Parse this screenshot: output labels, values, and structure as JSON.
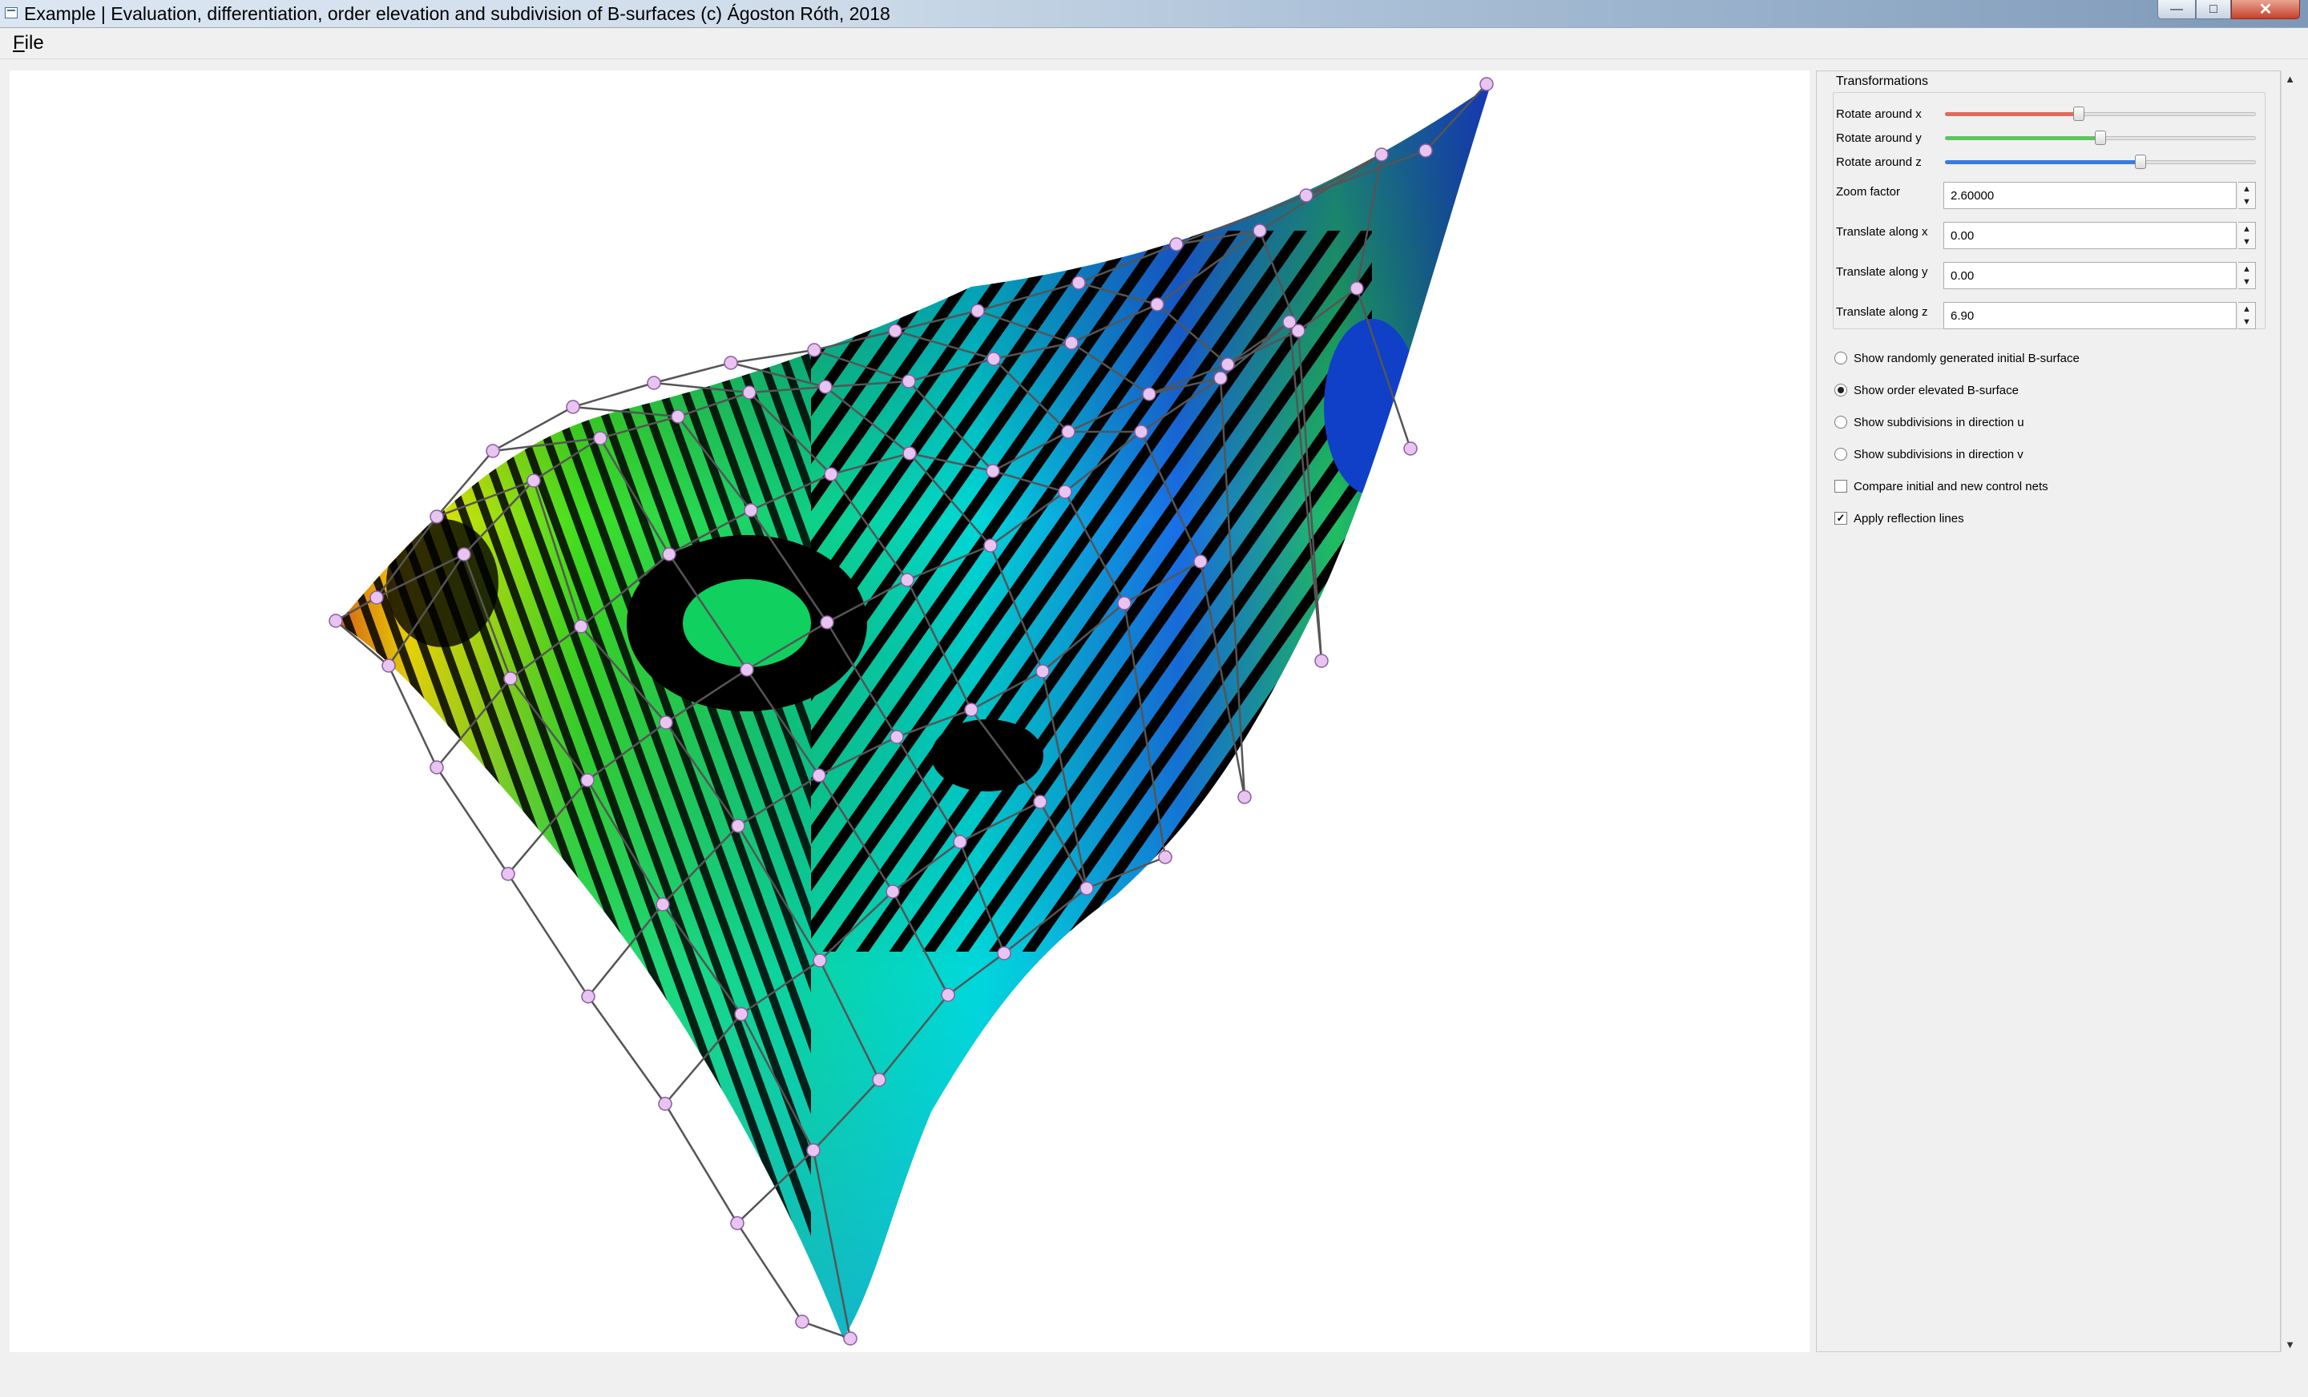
{
  "window": {
    "title": "Example | Evaluation, differentiation, order elevation and subdivision of B-surfaces (c) Ágoston Róth, 2018",
    "minimize_glyph": "—",
    "maximize_glyph": "□",
    "close_glyph": "✕"
  },
  "menu": {
    "file_mnemonic": "F",
    "file_rest": "ile"
  },
  "panel": {
    "group_title": "Transformations",
    "sliders": [
      {
        "label": "Rotate around x",
        "value": 0.43,
        "color": "#e06a5a"
      },
      {
        "label": "Rotate around y",
        "value": 0.5,
        "color": "#5cc65c"
      },
      {
        "label": "Rotate around z",
        "value": 0.63,
        "color": "#3a7be0"
      }
    ],
    "spinboxes": [
      {
        "label": "Zoom factor",
        "value": "2.60000"
      },
      {
        "label": "Translate along x",
        "value": "0.00"
      },
      {
        "label": "Translate along y",
        "value": "0.00"
      },
      {
        "label": "Translate along z",
        "value": "6.90"
      }
    ],
    "options": [
      {
        "label": "Show randomly generated initial B-surface",
        "checked": false
      },
      {
        "label": "Show order elevated B-surface",
        "checked": true
      },
      {
        "label": "Show subdivisions in direction u",
        "checked": false
      },
      {
        "label": "Show subdivisions in direction v",
        "checked": false
      }
    ],
    "checkboxes": [
      {
        "label": "Compare initial and new control nets",
        "checked": false
      },
      {
        "label": "Apply reflection lines",
        "checked": true
      }
    ]
  }
}
